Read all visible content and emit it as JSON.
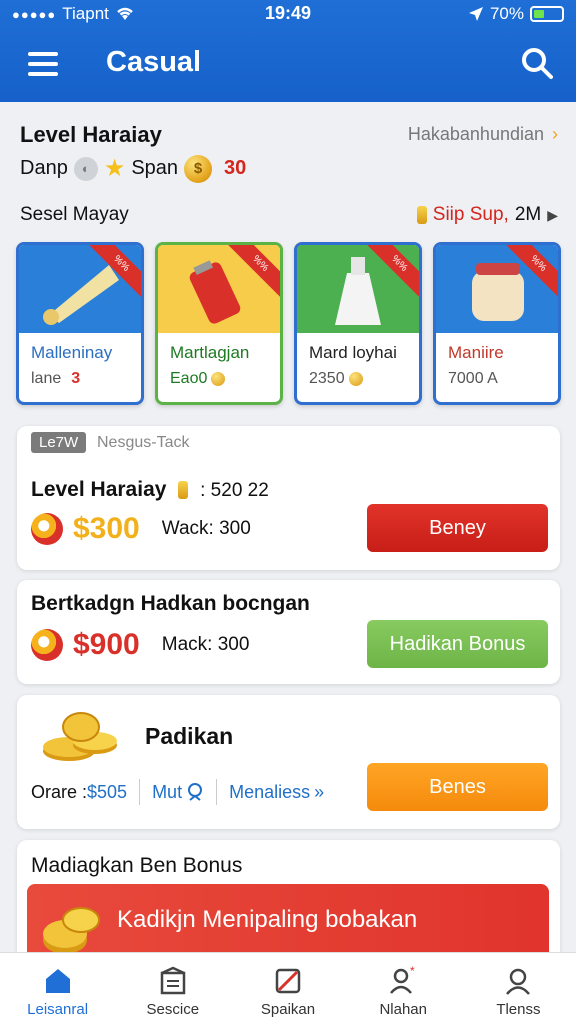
{
  "status": {
    "carrier": "Tiapnt",
    "time": "19:49",
    "battery": "70%"
  },
  "header": {
    "title": "Casual"
  },
  "level": {
    "title": "Level Haraiay",
    "link": "Hakabanhundian",
    "sub_label": "Danp",
    "sub_mid": "Span",
    "sub_value": "30"
  },
  "select": {
    "title": "Sesel Mayay",
    "right_red": "Siip Sup,",
    "right_value": "2M"
  },
  "products": [
    {
      "name": "Malleninay",
      "meta_label": "lane",
      "meta_value": "3",
      "name_color": "#2a6fbf",
      "border": "#2f6fd0",
      "bg": "#2a80d8"
    },
    {
      "name": "Martlagjan",
      "meta_label": "Eao0",
      "meta_value": "",
      "name_color": "#1e7a22",
      "border": "#5cb345",
      "bg": "#f6cc4a"
    },
    {
      "name": "Mard loyhai",
      "meta_label": "2350",
      "meta_value": "",
      "name_color": "#222",
      "border": "#2f6fd0",
      "bg": "#4caf50"
    },
    {
      "name": "Maniire",
      "meta_label": "7000 A",
      "meta_value": "",
      "name_color": "#c0392b",
      "border": "#2f6fd0",
      "bg": "#2a80d8"
    }
  ],
  "card1": {
    "tag": "Le7W",
    "tag_note": "Nesgus-Tack",
    "title": "Level Haraiay",
    "title_extra": ": 520  22",
    "price": "$300",
    "mack": "Wack: 300",
    "button": "Beney"
  },
  "card2": {
    "title": "Bertkadgn Hadkan bocngan",
    "price": "$900",
    "mack": "Mack: 300",
    "button": "Hadikan Bonus"
  },
  "card3": {
    "title": "Padikan",
    "orare": "Orare : ",
    "orare_val": "$505",
    "mut": "Mut",
    "menal": "Menaliess",
    "button": "Benes"
  },
  "card4": {
    "title": "Madiagkan Ben Bonus",
    "promo": "Kadikjn Menipaling bobakan"
  },
  "tabs": [
    {
      "label": "Leisanral",
      "icon": "home-icon"
    },
    {
      "label": "Sescice",
      "icon": "box-icon"
    },
    {
      "label": "Spaikan",
      "icon": "ticket-icon"
    },
    {
      "label": "Nlahan",
      "icon": "profile-alert-icon"
    },
    {
      "label": "Tlenss",
      "icon": "person-icon"
    }
  ],
  "colors": {
    "brand": "#1f6fd6",
    "red": "#d9302a",
    "gold": "#f2b01a",
    "green": "#6db447",
    "orange": "#f58a0c"
  }
}
